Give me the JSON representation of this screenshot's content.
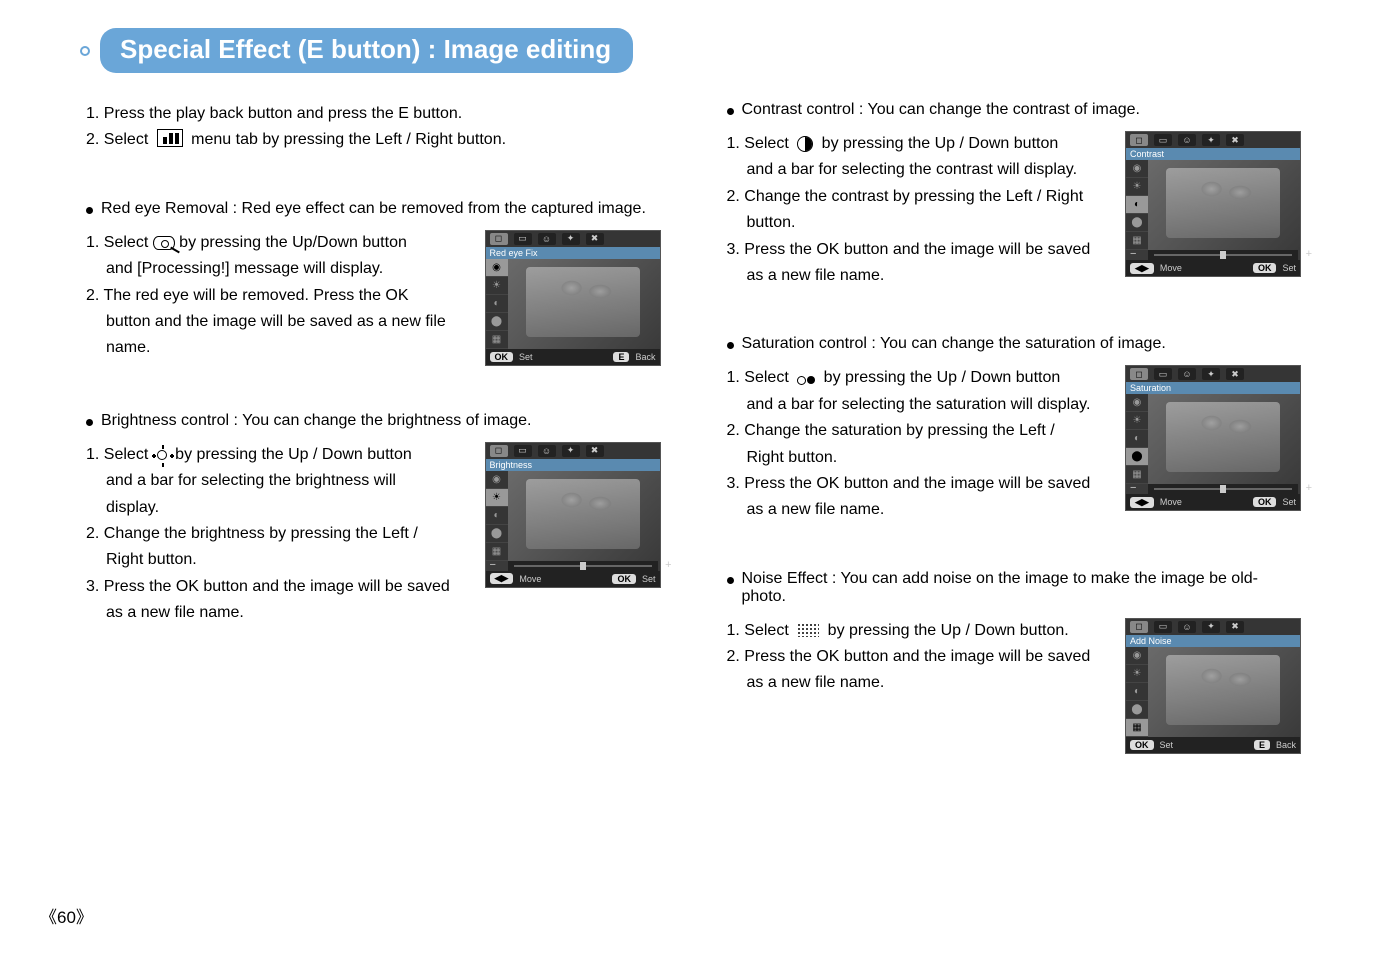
{
  "title": "Special Effect (E button) : Image editing",
  "intro": {
    "s1": "1. Press the play back button and press the E button.",
    "s2a": "2. Select",
    "s2b": "menu tab by pressing the Left / Right button."
  },
  "redeye": {
    "heading": "Red eye Removal : Red eye effect can be removed from the captured image.",
    "s1a": "1. Select",
    "s1b": "by pressing the  Up/Down button",
    "s1c": "and [Processing!] message will display.",
    "s2": "2. The red eye will be removed. Press the OK",
    "s2b": "button and the image will be saved as a new file",
    "s2c": "name.",
    "shot_label": "Red eye Fix",
    "foot_ok": "OK",
    "foot_set": "Set",
    "foot_e": "E",
    "foot_back": "Back"
  },
  "brightness": {
    "heading": "Brightness control : You can change the brightness of image.",
    "s1a": "1. Select",
    "s1b": "by pressing the Up / Down button",
    "s1c": "and a bar for selecting the brightness will",
    "s1d": "display.",
    "s2": "2. Change the brightness by pressing the Left /",
    "s2b": "Right button.",
    "s3": "3. Press the OK button and the image will be saved",
    "s3b": "as a new file name.",
    "shot_label": "Brightness",
    "foot_move": "Move",
    "foot_ok": "OK",
    "foot_set": "Set"
  },
  "contrast": {
    "heading": "Contrast control : You can change the contrast of image.",
    "s1a": "1. Select",
    "s1b": "by pressing the Up / Down button",
    "s1c": "and a bar for selecting the contrast will display.",
    "s2": "2. Change the contrast by pressing the Left / Right",
    "s2b": "button.",
    "s3": "3. Press the OK button and the image will be saved",
    "s3b": "as a new file name.",
    "shot_label": "Contrast",
    "foot_move": "Move",
    "foot_ok": "OK",
    "foot_set": "Set"
  },
  "saturation": {
    "heading": "Saturation control : You can change the saturation of image.",
    "s1a": "1. Select",
    "s1b": "by pressing the Up / Down button",
    "s1c": "and a bar for selecting the saturation will display.",
    "s2": "2. Change the saturation by pressing the Left /",
    "s2b": "Right button.",
    "s3": "3. Press the OK button and the image will be saved",
    "s3b": "as a new file name.",
    "shot_label": "Saturation",
    "foot_move": "Move",
    "foot_ok": "OK",
    "foot_set": "Set"
  },
  "noise": {
    "heading": "Noise Effect : You can add noise on the image to make the image be old-photo.",
    "s1a": "1. Select",
    "s1b": "by pressing the Up / Down button.",
    "s2": "2. Press the OK button and the image will be saved",
    "s2b": "as a new file name.",
    "shot_label": "Add Noise",
    "foot_ok": "OK",
    "foot_set": "Set",
    "foot_e": "E",
    "foot_back": "Back"
  },
  "page_number": "60",
  "icons": {
    "tab1": "◻",
    "tab2": "▭",
    "tab3": "☺",
    "tab4": "✦",
    "tab5": "✖",
    "arrows": "◀▶",
    "side_eye": "◉",
    "side_sun": "☀",
    "side_half": "◐",
    "side_drop": "⬤",
    "side_noise": "▦"
  }
}
